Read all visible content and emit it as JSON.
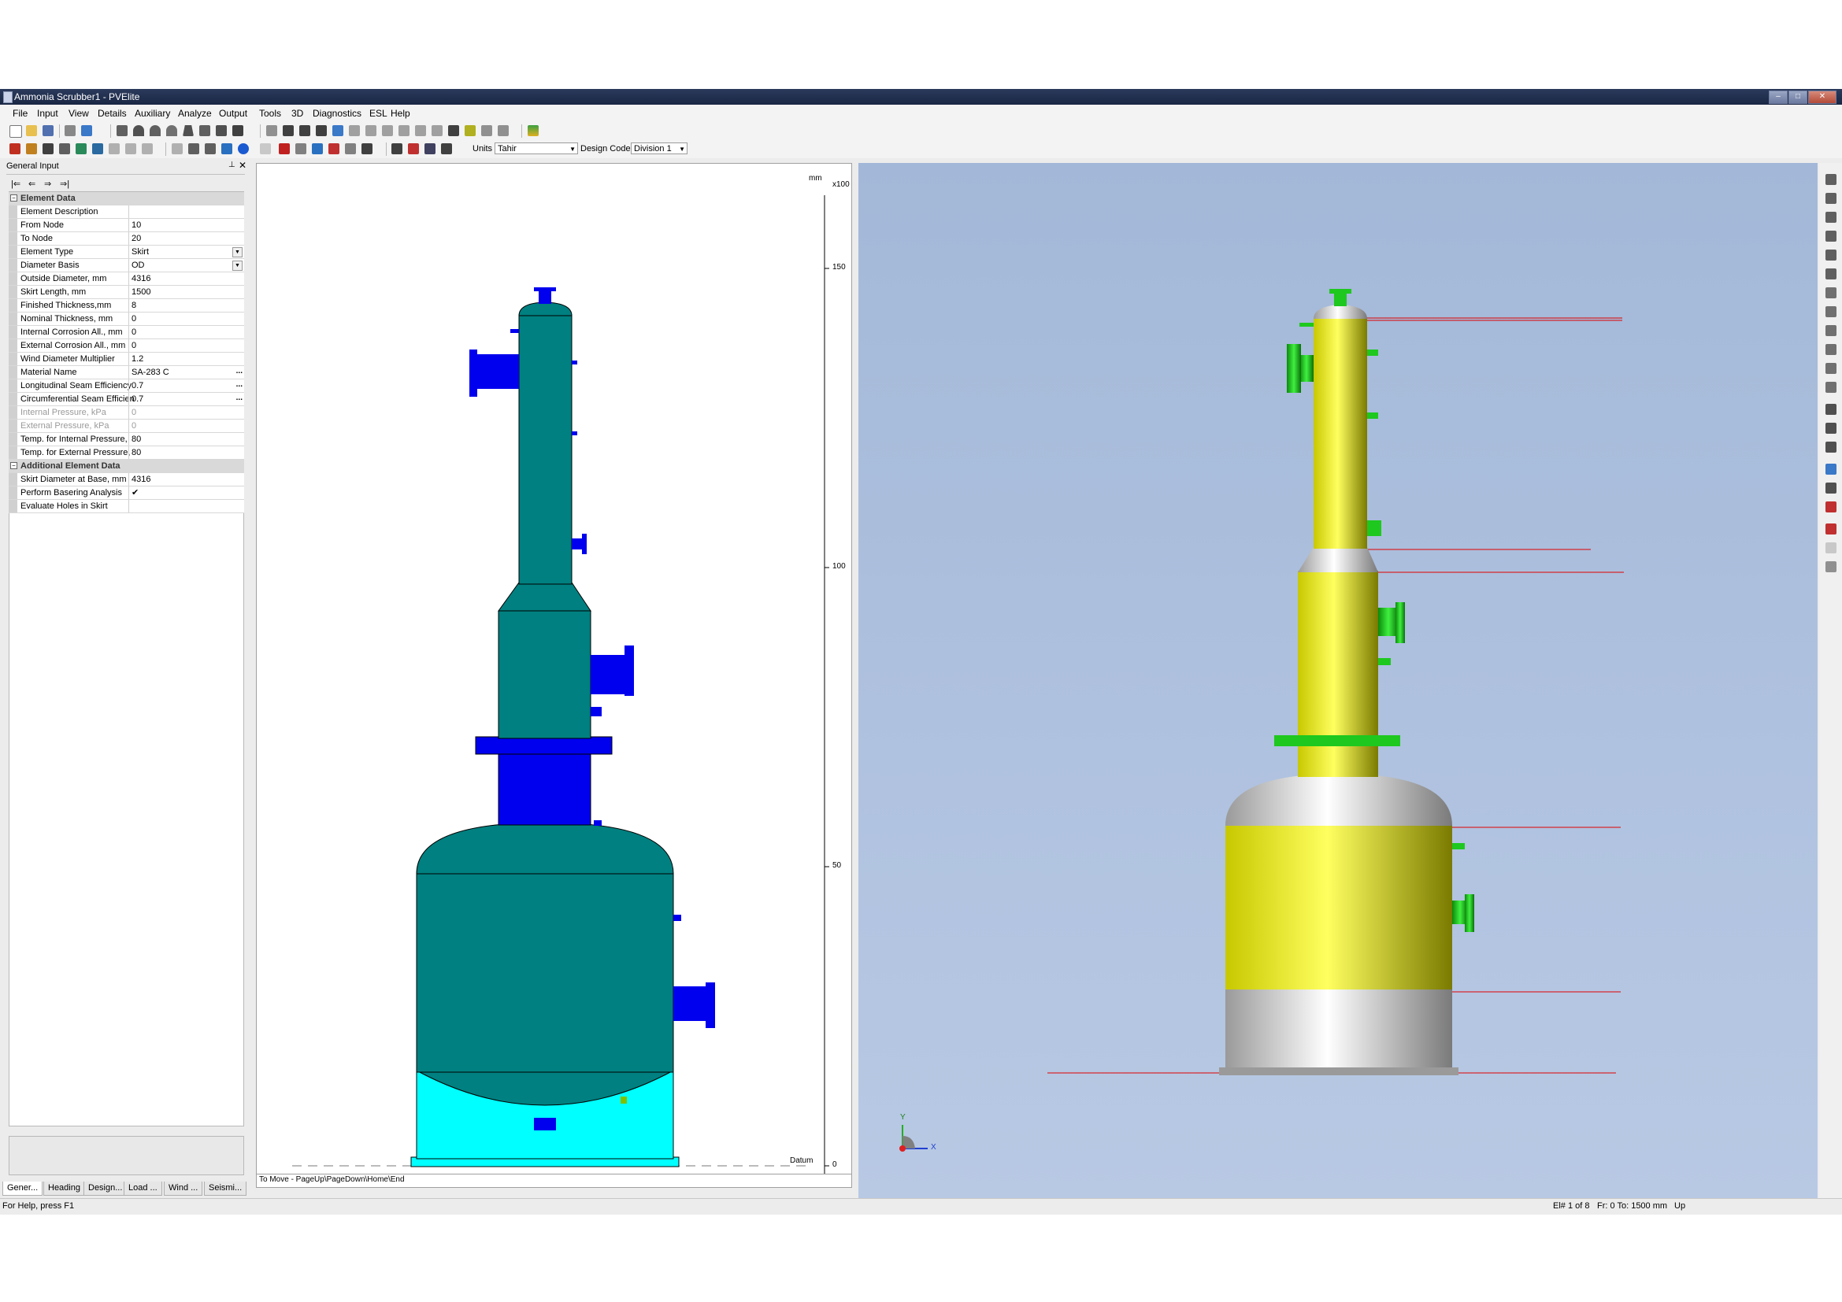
{
  "window": {
    "title": "Ammonia Scrubber1 - PVElite",
    "controls": [
      "–",
      "□",
      "✕"
    ]
  },
  "menu": [
    "File",
    "Input",
    "View",
    "Details",
    "Auxiliary",
    "Analyze",
    "Output",
    "Tools",
    "3D",
    "Diagnostics",
    "ESL",
    "Help"
  ],
  "toolbar": {
    "units_label": "Units",
    "units_value": "Tahir",
    "design_code_label": "Design Code",
    "design_code_value": "Division 1"
  },
  "panel": {
    "title": "General Input",
    "nav_buttons": [
      "|⇐",
      "⇐",
      "⇒",
      "⇒|"
    ],
    "categories": [
      {
        "name": "Element Data",
        "rows": [
          {
            "label": "Element Description",
            "value": ""
          },
          {
            "label": "From Node",
            "value": "10"
          },
          {
            "label": "To Node",
            "value": "20"
          },
          {
            "label": "Element Type",
            "value": "Skirt",
            "control": "dropdown"
          },
          {
            "label": "Diameter Basis",
            "value": "OD",
            "control": "dropdown"
          },
          {
            "label": "Outside Diameter, mm",
            "value": "4316"
          },
          {
            "label": "Skirt Length, mm",
            "value": "1500"
          },
          {
            "label": "Finished Thickness,mm",
            "value": "8"
          },
          {
            "label": "Nominal Thickness, mm",
            "value": "0"
          },
          {
            "label": "Internal Corrosion All., mm",
            "value": "0"
          },
          {
            "label": "External Corrosion All., mm",
            "value": "0"
          },
          {
            "label": "Wind Diameter Multiplier",
            "value": "1.2"
          },
          {
            "label": "Material Name",
            "value": "SA-283 C",
            "control": "ellipsis"
          },
          {
            "label": "Longitudinal Seam Efficiency",
            "value": "0.7",
            "control": "ellipsis"
          },
          {
            "label": "Circumferential Seam Efficiency",
            "value": "0.7",
            "control": "ellipsis"
          },
          {
            "label": "Internal Pressure, kPa",
            "value": "0",
            "disabled": true
          },
          {
            "label": "External Pressure, kPa",
            "value": "0",
            "disabled": true
          },
          {
            "label": "Temp. for Internal Pressure,",
            "value": "80"
          },
          {
            "label": "Temp. for External Pressure,",
            "value": "80"
          }
        ]
      },
      {
        "name": "Additional Element Data",
        "rows": [
          {
            "label": "Skirt Diameter at Base, mm",
            "value": "4316"
          },
          {
            "label": "Perform Basering Analysis",
            "value": "✔"
          },
          {
            "label": "Evaluate Holes in Skirt",
            "value": ""
          }
        ]
      }
    ],
    "tabs": [
      "Gener...",
      "Heading",
      "Design...",
      "Load ...",
      "Wind ...",
      "Seismi..."
    ]
  },
  "view2d": {
    "unit_label": "mm",
    "scale_label": "x100",
    "ticks": [
      "150",
      "100",
      "50",
      "0"
    ],
    "datum_label": "Datum",
    "hint": "To Move - PageUp\\PageDown\\Home\\End",
    "colors": {
      "shell": "#008080",
      "nozzle": "#0000ee",
      "skirt": "#00ffff"
    }
  },
  "view3d": {
    "axis_y": "Y",
    "axis_x": "X",
    "colors": {
      "shell": "#f2f200",
      "head": "#b0b0b0",
      "nozzle": "#1ec81e",
      "dimension": "#e00000"
    }
  },
  "status": {
    "help": "For Help, press F1",
    "element": "El# 1 of 8",
    "from_to": "Fr: 0 To: 1500 mm",
    "direction": "Up"
  }
}
